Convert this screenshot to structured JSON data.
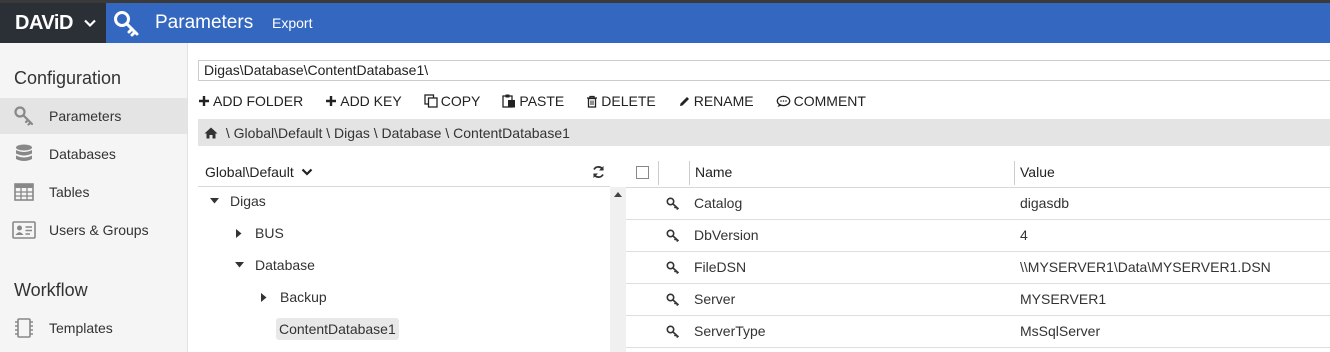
{
  "app": {
    "brand": "DAViD",
    "title": "Parameters",
    "export_label": "Export"
  },
  "sidebar": {
    "configuration_title": "Configuration",
    "items": [
      {
        "label": "Parameters",
        "icon": "key-icon",
        "active": true
      },
      {
        "label": "Databases",
        "icon": "database-icon"
      },
      {
        "label": "Tables",
        "icon": "table-icon"
      },
      {
        "label": "Users & Groups",
        "icon": "id-card-icon"
      }
    ],
    "workflow_title": "Workflow",
    "workflow_items": [
      {
        "label": "Templates",
        "icon": "template-icon"
      }
    ]
  },
  "path": {
    "value": "Digas\\Database\\ContentDatabase1\\"
  },
  "toolbar": {
    "add_folder": "ADD FOLDER",
    "add_key": "ADD KEY",
    "copy": "COPY",
    "paste": "PASTE",
    "delete": "DELETE",
    "rename": "RENAME",
    "comment": "COMMENT"
  },
  "breadcrumb": {
    "parts": [
      " \\ Global\\Default",
      " \\ Digas",
      " \\ Database",
      " \\ ContentDatabase1"
    ]
  },
  "tree": {
    "root_selector": "Global\\Default",
    "nodes": [
      {
        "label": "Digas",
        "expanded": true
      },
      {
        "label": "BUS",
        "expanded": false
      },
      {
        "label": "Database",
        "expanded": true
      },
      {
        "label": "Backup",
        "expanded": false
      },
      {
        "label": "ContentDatabase1",
        "selected": true
      }
    ]
  },
  "grid": {
    "columns": {
      "name": "Name",
      "value": "Value"
    },
    "rows": [
      {
        "name": "Catalog",
        "value": "digasdb"
      },
      {
        "name": "DbVersion",
        "value": "4"
      },
      {
        "name": "FileDSN",
        "value": "\\\\MYSERVER1\\Data\\MYSERVER1.DSN"
      },
      {
        "name": "Server",
        "value": "MYSERVER1"
      },
      {
        "name": "ServerType",
        "value": "MsSqlServer"
      }
    ]
  },
  "colors": {
    "header": "#3468c0",
    "brand_bg": "#2b2f36",
    "sidebar_bg": "#f5f5f5",
    "breadcrumb_bg": "#e4e4e4"
  }
}
